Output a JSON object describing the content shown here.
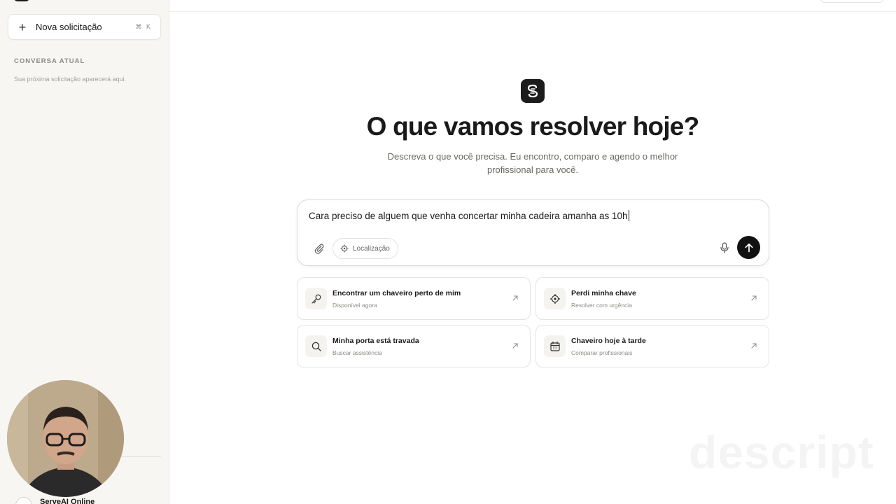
{
  "sidebar": {
    "new_request_label": "Nova solicitação",
    "new_request_shortcut": "⌘ K",
    "section_title": "CONVERSA ATUAL",
    "empty_hint": "Sua próxima solicitação aparecerá aqui.",
    "status_label": "ServeAI Online"
  },
  "main": {
    "headline": "O que vamos resolver hoje?",
    "subtitle": "Descreva o que você precisa. Eu encontro, comparo e agendo o melhor profissional para você.",
    "composer": {
      "text": "Cara preciso de alguem que venha concertar minha cadeira amanha as 10h",
      "location_label": "Localização"
    },
    "suggestions": [
      {
        "title": "Encontrar um chaveiro perto de mim",
        "subtitle": "Disponível agora",
        "icon": "key-icon"
      },
      {
        "title": "Perdi minha chave",
        "subtitle": "Resolver com urgência",
        "icon": "locate-icon"
      },
      {
        "title": "Minha porta está travada",
        "subtitle": "Buscar assistência",
        "icon": "search-icon"
      },
      {
        "title": "Chaveiro hoje à tarde",
        "subtitle": "Comparar profissionais",
        "icon": "calendar-icon"
      }
    ]
  },
  "watermark": "descript",
  "colors": {
    "accent": "#111111",
    "sidebar_bg": "#f7f6f3",
    "border": "#e6e4df"
  }
}
